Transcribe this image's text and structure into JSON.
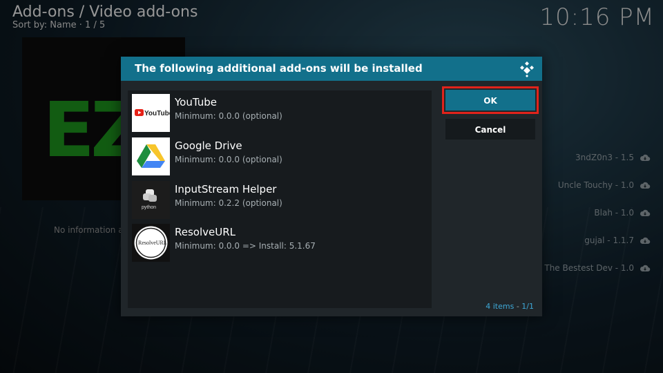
{
  "header": {
    "title": "Add-ons / Video add-ons",
    "sort": "Sort by: Name  ·  1 / 5",
    "clock": "10:16 PM"
  },
  "background": {
    "no_info": "No information a",
    "right_list": [
      {
        "label": "3ndZ0n3 - 1.5"
      },
      {
        "label": "Uncle Touchy - 1.0"
      },
      {
        "label": "Blah - 1.0"
      },
      {
        "label": "gujal - 1.1.7"
      },
      {
        "label": "The Bestest Dev - 1.0"
      }
    ]
  },
  "dialog": {
    "title": "The following additional add-ons will be installed",
    "items": [
      {
        "name": "YouTube",
        "sub": "Minimum: 0.0.0 (optional)",
        "icon": "youtube-icon"
      },
      {
        "name": "Google Drive",
        "sub": "Minimum: 0.0.0 (optional)",
        "icon": "google-drive-icon"
      },
      {
        "name": "InputStream Helper",
        "sub": "Minimum: 0.2.2 (optional)",
        "icon": "python-icon"
      },
      {
        "name": "ResolveURL",
        "sub": "Minimum: 0.0.0 => Install: 5.1.67",
        "icon": "resolveurl-icon"
      }
    ],
    "ok_label": "OK",
    "cancel_label": "Cancel",
    "count_items": "4 items",
    "count_sep": " - ",
    "count_page": "1/1"
  },
  "colors": {
    "accent": "#12708b",
    "highlight_border": "#e0231b"
  }
}
